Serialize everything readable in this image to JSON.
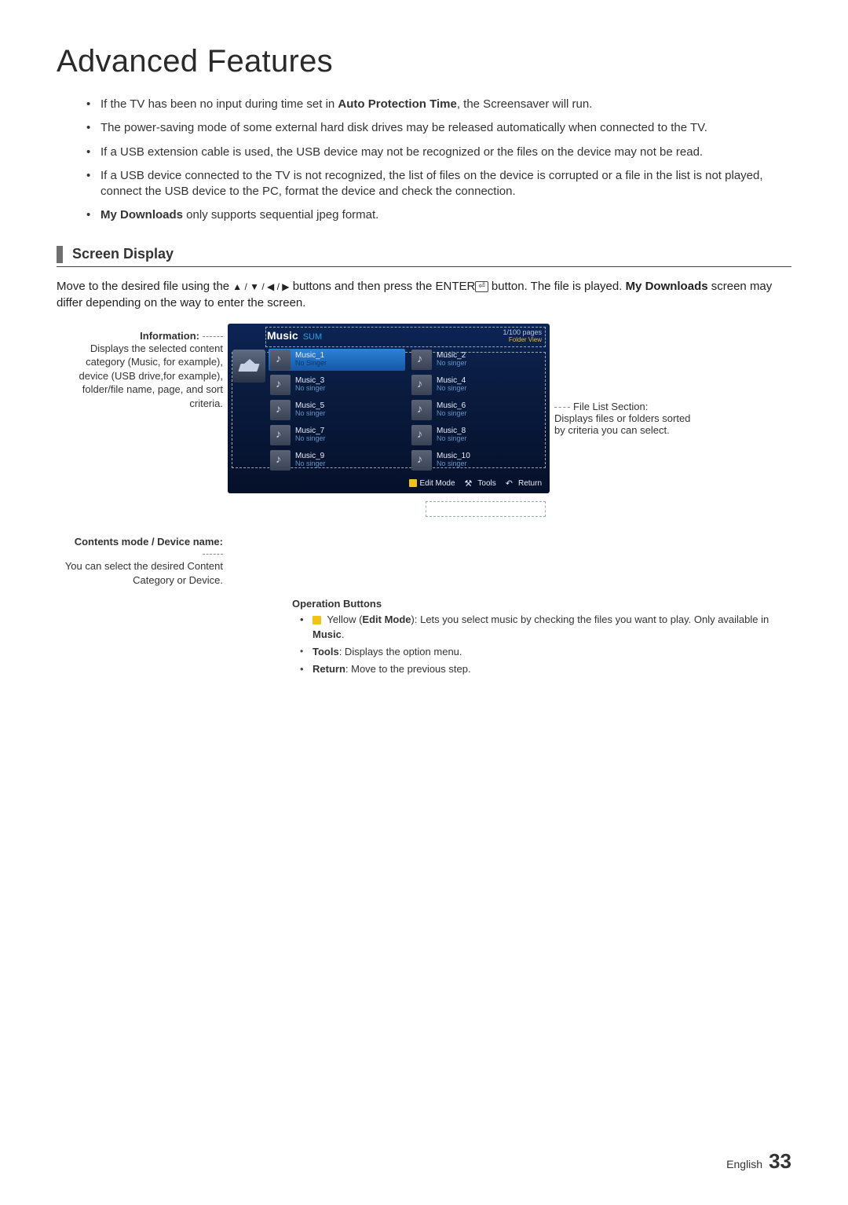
{
  "page_title": "Advanced Features",
  "bullets": [
    {
      "pre": "If the TV has been no input during time set in ",
      "b": "Auto Protection Time",
      "post": ", the Screensaver will run."
    },
    {
      "pre": "The power-saving mode of some external hard disk drives may be released automatically when connected to the TV.",
      "b": "",
      "post": ""
    },
    {
      "pre": "If a USB extension cable is used, the USB device may not be recognized or the files on the device may not be read.",
      "b": "",
      "post": ""
    },
    {
      "pre": "If a USB device connected to the TV is not recognized, the list of files on the device is corrupted or a file in the list is not played, connect the USB device to the PC, format the device and check the connection.",
      "b": "",
      "post": ""
    },
    {
      "pre": "",
      "b": "My Downloads",
      "post": " only supports sequential jpeg format."
    }
  ],
  "section_heading": "Screen Display",
  "intro": {
    "p1a": "Move to the desired file using the ",
    "arrows": "▲ / ▼ / ◀ / ▶",
    "p1b": " buttons and then press the ENTER",
    "enter_icon": "⏎",
    "p1c": " button. The file is played. ",
    "bold1": "My Downloads",
    "p1d": " screen may differ depending on the way to enter the screen."
  },
  "labels": {
    "info_title": "Information:",
    "info_body": "Displays the selected content category (Music, for example), device (USB drive,for example), folder/file name, page, and sort criteria.",
    "mode_title": "Contents mode / Device name:",
    "mode_body": "You can select the desired Content Category or Device.",
    "filelist_title": "File List Section:",
    "filelist_body": "Displays files or folders sorted by criteria you can select."
  },
  "tv": {
    "category": "Music",
    "device": "SUM",
    "pages": "1/100 pages",
    "folder_view": "Folder View",
    "files": [
      {
        "name": "Music_1",
        "sub": "No Singer",
        "selected": true
      },
      {
        "name": "Music_2",
        "sub": "No singer"
      },
      {
        "name": "Music_3",
        "sub": "No singer"
      },
      {
        "name": "Music_4",
        "sub": "No singer"
      },
      {
        "name": "Music_5",
        "sub": "No singer"
      },
      {
        "name": "Music_6",
        "sub": "No singer"
      },
      {
        "name": "Music_7",
        "sub": "No singer"
      },
      {
        "name": "Music_8",
        "sub": "No singer"
      },
      {
        "name": "Music_9",
        "sub": "No singer"
      },
      {
        "name": "Music_10",
        "sub": "No singer"
      }
    ],
    "footer": {
      "edit_label": "Edit Mode",
      "tools_label": "Tools",
      "return_label": "Return"
    }
  },
  "op": {
    "heading": "Operation Buttons",
    "yellow_pre": " Yellow (",
    "yellow_bold": "Edit Mode",
    "yellow_post": "): Lets you select music by checking the files you want to play. Only available in ",
    "yellow_bold2": "Music",
    "yellow_end": ".",
    "tools_bold": "Tools",
    "tools_post": ": Displays the option menu.",
    "return_bold": "Return",
    "return_post": ": Move to the previous step."
  },
  "footer": {
    "lang": "English",
    "page": "33"
  }
}
